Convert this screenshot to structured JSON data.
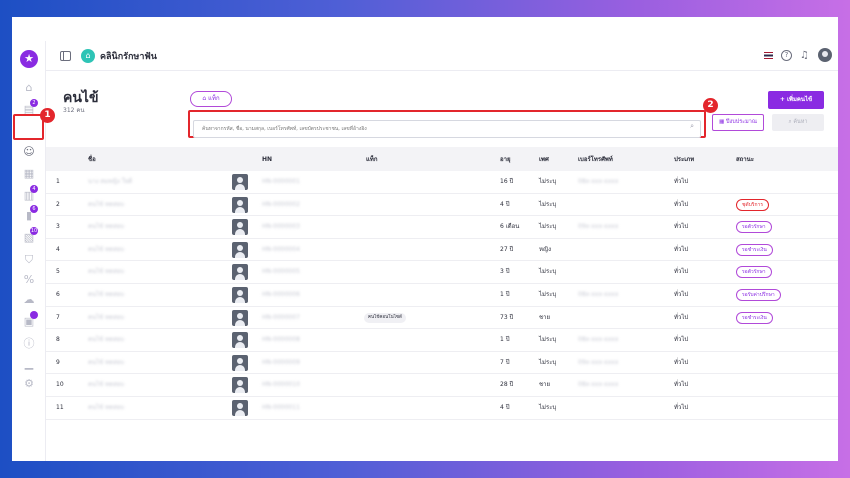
{
  "app": {
    "clinic_name": "คลินิกรักษาฟัน"
  },
  "page": {
    "title": "คนไข้",
    "count": "312 คน"
  },
  "buttons": {
    "tag": "แท็ก",
    "add_patient": "+ เพิ่มคนไข้",
    "calendar": "ปีงบประมาณ",
    "find": "ค้นหา"
  },
  "search": {
    "placeholder": "ค้นหาจากรหัส, ชื่อ, นามสกุล, เบอร์โทรศัพท์, เลขบัตรประชาชน, เลขที่อ้างอิง"
  },
  "callouts": [
    "1",
    "2"
  ],
  "rail": {
    "badges": [
      "2",
      "4",
      "6",
      "10"
    ]
  },
  "table": {
    "headers": [
      "ชื่อ",
      "HN",
      "แท็ก",
      "อายุ",
      "เพศ",
      "เบอร์โทรศัพท์",
      "ประเภท",
      "สถานะ"
    ],
    "rows": [
      {
        "no": "1",
        "name": "นาง สมหญิง ใจดี",
        "hn": "HN-0000001",
        "tag": "",
        "age": "16 ปี",
        "gender": "ไม่ระบุ",
        "phone": "08x-xxx-xxxx",
        "type": "ทั่วไป",
        "status": ""
      },
      {
        "no": "2",
        "name": "คนไข้ ทดสอบ",
        "hn": "HN-0000002",
        "tag": "",
        "age": "4 ปี",
        "gender": "ไม่ระบุ",
        "phone": "",
        "type": "ทั่วไป",
        "status": "ชุดับริการ"
      },
      {
        "no": "3",
        "name": "คนไข้ ทดสอบ",
        "hn": "HN-0000003",
        "tag": "",
        "age": "6 เดือน",
        "gender": "ไม่ระบุ",
        "phone": "09x-xxx-xxxx",
        "type": "ทั่วไป",
        "status": "รอตัวรักษา"
      },
      {
        "no": "4",
        "name": "คนไข้ ทดสอบ",
        "hn": "HN-0000004",
        "tag": "",
        "age": "27 ปี",
        "gender": "หญิง",
        "phone": "",
        "type": "ทั่วไป",
        "status": "รอชำระเงิน"
      },
      {
        "no": "5",
        "name": "คนไข้ ทดสอบ",
        "hn": "HN-0000005",
        "tag": "",
        "age": "3 ปี",
        "gender": "ไม่ระบุ",
        "phone": "",
        "type": "ทั่วไป",
        "status": "รอตัวรักษา"
      },
      {
        "no": "6",
        "name": "คนไข้ ทดสอบ",
        "hn": "HN-0000006",
        "tag": "",
        "age": "1 ปี",
        "gender": "ไม่ระบุ",
        "phone": "08x-xxx-xxxx",
        "type": "ทั่วไป",
        "status": "รอรับค่าปรึกษา"
      },
      {
        "no": "7",
        "name": "คนไข้ ทดสอบ",
        "hn": "HN-0000007",
        "tag": "คนไข้คอนโนไซต์",
        "age": "73 ปี",
        "gender": "ชาย",
        "phone": "",
        "type": "ทั่วไป",
        "status": "รอชำระเงิน"
      },
      {
        "no": "8",
        "name": "คนไข้ ทดสอบ",
        "hn": "HN-0000008",
        "tag": "",
        "age": "1 ปี",
        "gender": "ไม่ระบุ",
        "phone": "08x-xxx-xxxx",
        "type": "ทั่วไป",
        "status": ""
      },
      {
        "no": "9",
        "name": "คนไข้ ทดสอบ",
        "hn": "HN-0000009",
        "tag": "",
        "age": "7 ปี",
        "gender": "ไม่ระบุ",
        "phone": "09x-xxx-xxxx",
        "type": "ทั่วไป",
        "status": ""
      },
      {
        "no": "10",
        "name": "คนไข้ ทดสอบ",
        "hn": "HN-0000010",
        "tag": "",
        "age": "28 ปี",
        "gender": "ชาย",
        "phone": "08x-xxx-xxxx",
        "type": "ทั่วไป",
        "status": ""
      },
      {
        "no": "11",
        "name": "คนไข้ ทดสอบ",
        "hn": "HN-0000011",
        "tag": "",
        "age": "4 ปี",
        "gender": "ไม่ระบุ",
        "phone": "",
        "type": "ทั่วไป",
        "status": ""
      }
    ]
  },
  "colors": {
    "accent": "#8a2be2",
    "callout": "#e3262c"
  }
}
